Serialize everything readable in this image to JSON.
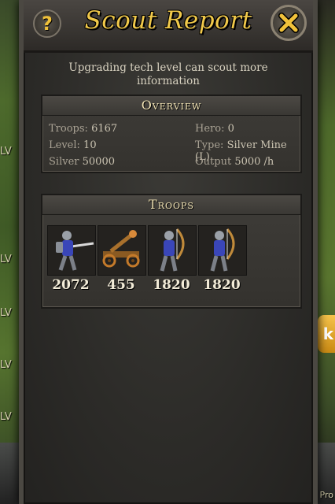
{
  "dialog": {
    "title": "Scout Report",
    "help_label": "?",
    "notice": "Upgrading tech level can scout more information"
  },
  "overview": {
    "heading": "Overview",
    "troops_label": "Troops:",
    "troops_value": "6167",
    "level_label": "Level:",
    "level_value": "10",
    "silver_label": "Silver",
    "silver_value": "50000",
    "hero_label": "Hero:",
    "hero_value": "0",
    "type_label": "Type:",
    "type_value": "Silver Mine (L)",
    "output_label": "Output",
    "output_value": "5000 /h"
  },
  "troops": {
    "heading": "Troops",
    "units": [
      {
        "icon": "swordsman-icon",
        "count": "2072"
      },
      {
        "icon": "catapult-icon",
        "count": "455"
      },
      {
        "icon": "archer-icon",
        "count": "1820"
      },
      {
        "icon": "archer-icon",
        "count": "1820"
      }
    ]
  },
  "background": {
    "level_tags": [
      "LV",
      "LV",
      "LV",
      "LV",
      "LV"
    ],
    "side_button": "k",
    "corner_text": "Pro"
  },
  "colors": {
    "title_gold": "#f1c94a",
    "panel_bg": "#3e3c38",
    "text_light": "#f3ecd8"
  }
}
